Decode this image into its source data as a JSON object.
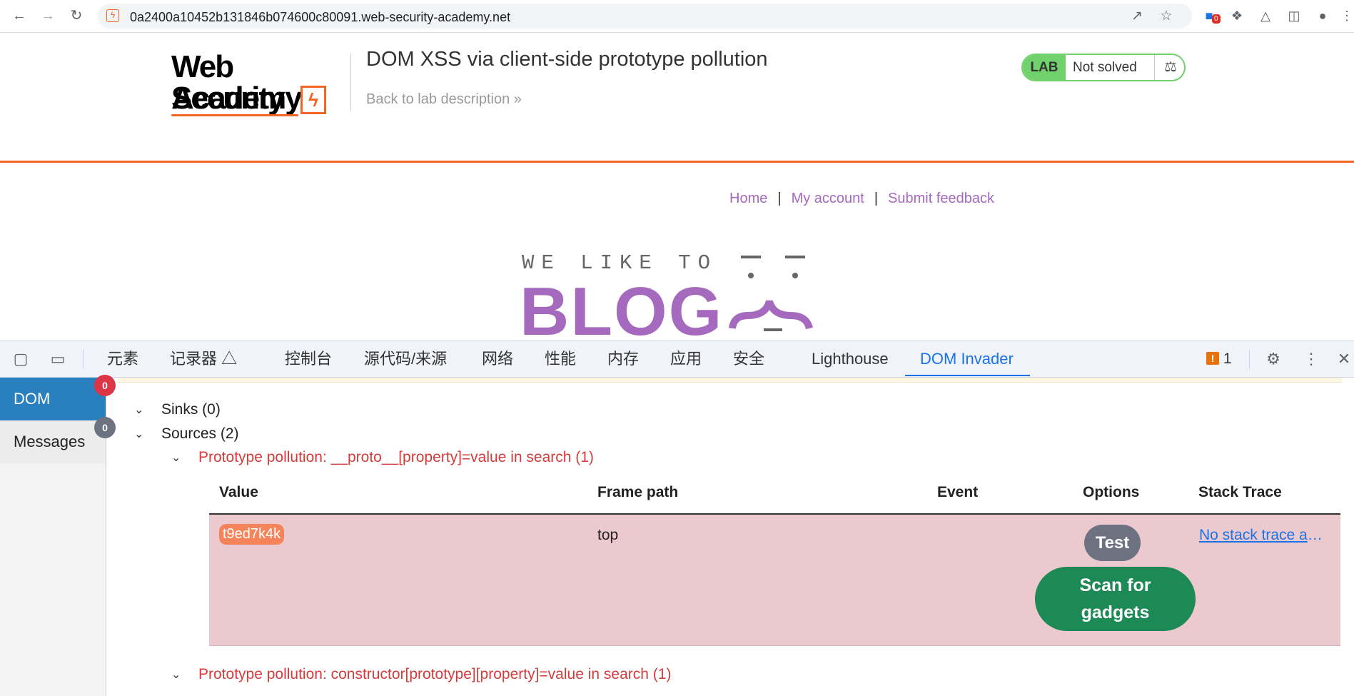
{
  "browser": {
    "url": "0a2400a10452b131846b074600c80091.web-security-academy.net",
    "extension_badge": "0"
  },
  "lab": {
    "logo_line1": "Web Security",
    "logo_line2": "Academy",
    "title": "DOM XSS via client-side prototype pollution",
    "back_link": "Back to lab description",
    "badge_label": "LAB",
    "status": "Not solved"
  },
  "blog": {
    "nav": [
      "Home",
      "My account",
      "Submit feedback"
    ],
    "nav_separator": "|",
    "tagline": "WE LIKE TO",
    "wordmark": "BLOG"
  },
  "devtools": {
    "tabs": [
      "元素",
      "记录器",
      "控制台",
      "源代码/来源",
      "网络",
      "性能",
      "内存",
      "应用",
      "安全",
      "Lighthouse",
      "DOM Invader"
    ],
    "active_tab": "DOM Invader",
    "issues_count": "1",
    "accent": "#1a73e8"
  },
  "invader": {
    "sidebar": [
      {
        "label": "DOM",
        "count": "0",
        "active": true
      },
      {
        "label": "Messages",
        "count": "0",
        "active": false
      }
    ],
    "sinks_label": "Sinks (0)",
    "sources_label": "Sources (2)",
    "source_1": "Prototype pollution: __proto__[property]=value in search (1)",
    "source_2": "Prototype pollution: constructor[prototype][property]=value in search (1)",
    "columns": [
      "Value",
      "Frame path",
      "Event",
      "Options",
      "Stack Trace"
    ],
    "row": {
      "value": "t9ed7k4k",
      "frame_path": "top",
      "event": "",
      "test_button": "Test",
      "scan_button": "Scan for gadgets",
      "stack_trace": "No stack trace available"
    },
    "colors": {
      "row_bg": "#ecc9ce",
      "scan_green": "#1d8a55",
      "source_red": "#d63b3b"
    }
  }
}
